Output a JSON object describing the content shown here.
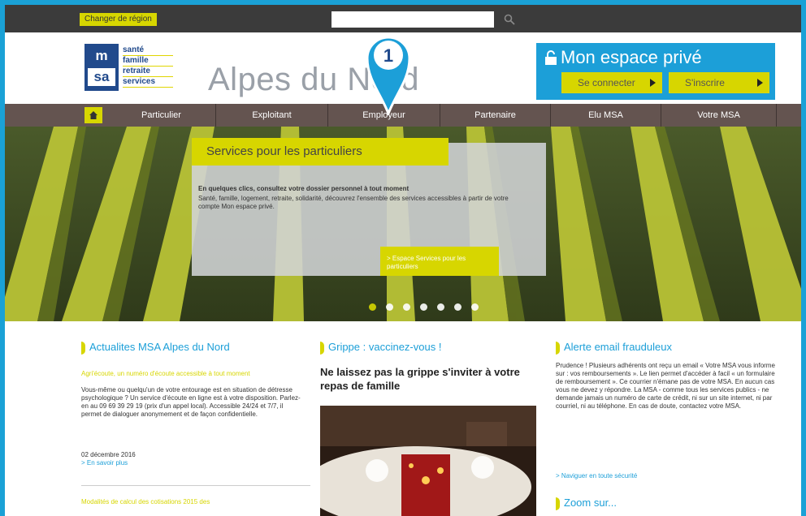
{
  "topbar": {
    "region_button": "Changer de région",
    "search_placeholder": ""
  },
  "logo": {
    "letters_top": "m",
    "letters_bottom": "sa",
    "tagline": [
      "santé",
      "famille",
      "retraite",
      "services"
    ]
  },
  "header": {
    "region_title": "Alpes du Nord"
  },
  "private_space": {
    "title": "Mon espace privé",
    "connect_label": "Se connecter",
    "signup_label": "S'inscrire"
  },
  "nav": {
    "items": [
      "Particulier",
      "Exploitant",
      "Employeur",
      "Partenaire",
      "Elu MSA",
      "Votre MSA"
    ]
  },
  "marker": {
    "number": "1"
  },
  "hero": {
    "title": "Services pour les particuliers",
    "lead": "En quelques clics, consultez votre dossier personnel à tout moment",
    "text": "Santé, famille, logement, retraite, solidarité, découvrez l'ensemble des services accessibles à partir de votre compte Mon espace privé.",
    "link": "> Espace Services pour les particuliers",
    "slides": 7,
    "active_slide": 1
  },
  "news": {
    "heading": "Actualites MSA Alpes du Nord",
    "item_title": "Agri'écoute, un numéro d'écoute accessible à tout moment",
    "item_body": "Vous-même ou quelqu'un de votre entourage est en situation de détresse psychologique ? Un service d'écoute en ligne est à votre disposition. Parlez-en au 09 69 39 29 19 (prix d'un appel local). Accessible 24/24 et 7/7, il permet de dialoguer anonymement et de façon confidentielle.",
    "item_date": "02 décembre 2016",
    "more_link": "> En savoir plus",
    "next_title": "Modalités de calcul des cotisations 2015 des"
  },
  "flu": {
    "heading": "Grippe : vaccinez-vous !",
    "title": "Ne laissez pas la grippe s'inviter à votre repas de famille"
  },
  "alert": {
    "heading": "Alerte email frauduleux",
    "body": "Prudence ! Plusieurs adhérents ont reçu un email « Votre MSA vous informe sur : vos remboursements ». Le lien permet d'accéder à facil « un formulaire de remboursement ». Ce courrier n'émane pas de votre MSA. En aucun cas vous ne devez y répondre. La MSA - comme tous les services publics - ne demande jamais un numéro de carte de crédit, ni sur un site internet, ni par courriel, ni au téléphone. En cas de doute, contactez votre MSA.",
    "link": "> Naviguer en toute sécurité",
    "zoom_heading": "Zoom sur..."
  },
  "colors": {
    "accent_yellow": "#d7d600",
    "brand_blue": "#1c9fd8",
    "nav_brown": "#645450",
    "logo_blue": "#214a8c"
  }
}
